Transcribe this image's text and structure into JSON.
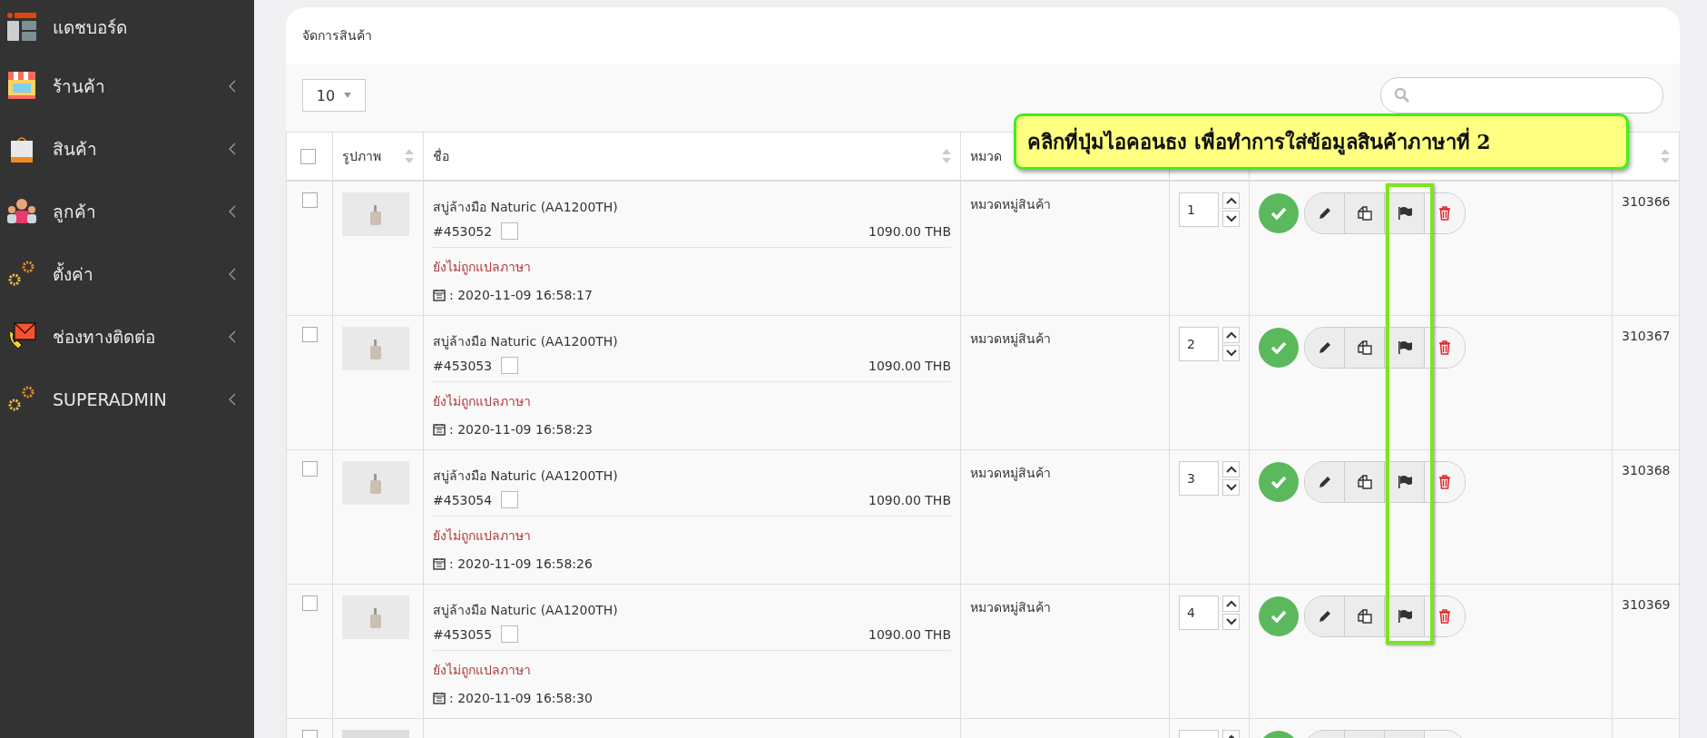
{
  "sidebar": {
    "items": [
      {
        "label": "แดชบอร์ด",
        "expandable": false
      },
      {
        "label": "ร้านค้า",
        "expandable": true
      },
      {
        "label": "สินค้า",
        "expandable": true
      },
      {
        "label": "ลูกค้า",
        "expandable": true
      },
      {
        "label": "ตั้งค่า",
        "expandable": true
      },
      {
        "label": "ช่องทางติดต่อ",
        "expandable": true
      },
      {
        "label": "SUPERADMIN",
        "expandable": true
      }
    ]
  },
  "panel": {
    "title": "จัดการสินค้า",
    "page_size": "10"
  },
  "table": {
    "select_all_checked": false,
    "columns": [
      {
        "label": "รูปภาพ",
        "sortable": true
      },
      {
        "label": "ชื่อ",
        "sortable": true
      },
      {
        "label": "หมวด",
        "sortable": false
      },
      {
        "sortable": false
      },
      {
        "sortable": false
      },
      {
        "sortable": true
      }
    ],
    "rows": [
      {
        "checked": false,
        "name": "สบู่ล้างมือ Naturic (AA1200TH)",
        "code": "#453052",
        "code_checked": false,
        "price": "1090.00 THB",
        "translation": "ยังไม่ถูกแปลภาษา",
        "date": ": 2020-11-09 16:58:17",
        "category": "หมวดหมู่สินค้า",
        "order": "1",
        "active": true,
        "id": "310366"
      },
      {
        "checked": false,
        "name": "สบู่ล้างมือ Naturic (AA1200TH)",
        "code": "#453053",
        "code_checked": false,
        "price": "1090.00 THB",
        "translation": "ยังไม่ถูกแปลภาษา",
        "date": ": 2020-11-09 16:58:23",
        "category": "หมวดหมู่สินค้า",
        "order": "2",
        "active": true,
        "id": "310367"
      },
      {
        "checked": false,
        "name": "สบู่ล้างมือ Naturic (AA1200TH)",
        "code": "#453054",
        "code_checked": false,
        "price": "1090.00 THB",
        "translation": "ยังไม่ถูกแปลภาษา",
        "date": ": 2020-11-09 16:58:26",
        "category": "หมวดหมู่สินค้า",
        "order": "3",
        "active": true,
        "id": "310368"
      },
      {
        "checked": false,
        "name": "สบู่ล้างมือ Naturic (AA1200TH)",
        "code": "#453055",
        "code_checked": false,
        "price": "1090.00 THB",
        "translation": "ยังไม่ถูกแปลภาษา",
        "date": ": 2020-11-09 16:58:30",
        "category": "หมวดหมู่สินค้า",
        "order": "4",
        "active": true,
        "id": "310369"
      }
    ],
    "partial_row": {
      "checked": false
    }
  },
  "callout": {
    "text": "คลิกที่ปุ่มไอคอนธง เพื่อทำการใส่ข้อมูลสินค้าภาษาที่ 2"
  }
}
